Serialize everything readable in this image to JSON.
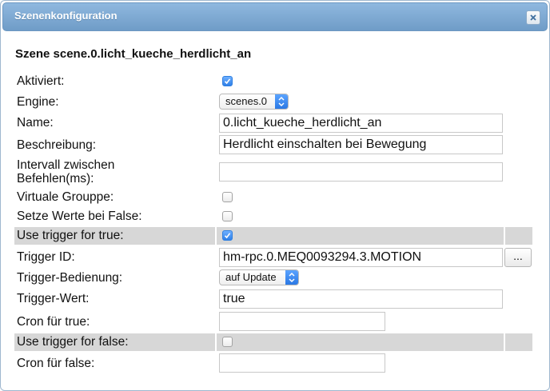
{
  "dialog": {
    "title": "Szenenkonfiguration",
    "close_icon": "close-icon",
    "heading": "Szene scene.0.licht_kueche_herdlicht_an"
  },
  "fields": {
    "aktiviert": {
      "label": "Aktiviert:",
      "checked": true
    },
    "engine": {
      "label": "Engine:",
      "value": "scenes.0"
    },
    "name": {
      "label": "Name:",
      "value": "0.licht_kueche_herdlicht_an"
    },
    "beschreibung": {
      "label": "Beschreibung:",
      "value": "Herdlicht einschalten bei Bewegung"
    },
    "intervall": {
      "label": "Intervall zwischen Befehlen(ms):",
      "value": ""
    },
    "virtuale_gruppe": {
      "label": "Virtuale Grouppe:",
      "checked": false
    },
    "setze_werte": {
      "label": "Setze Werte bei False:",
      "checked": false
    },
    "trigger_true": {
      "label": "Use trigger for true:",
      "checked": true
    },
    "trigger_id": {
      "label": "Trigger ID:",
      "value": "hm-rpc.0.MEQ0093294.3.MOTION",
      "button_label": "..."
    },
    "trigger_bedienung": {
      "label": "Trigger-Bedienung:",
      "value": "auf Update"
    },
    "trigger_wert": {
      "label": "Trigger-Wert:",
      "value": "true"
    },
    "cron_true": {
      "label": "Cron für true:",
      "value": ""
    },
    "trigger_false": {
      "label": "Use trigger for false:",
      "checked": false
    },
    "cron_false": {
      "label": "Cron für false:",
      "value": ""
    }
  },
  "colors": {
    "titlebar": "#7aa7d3",
    "highlight_row": "#d7d7d7",
    "checkbox_on": "#2f80e8"
  }
}
